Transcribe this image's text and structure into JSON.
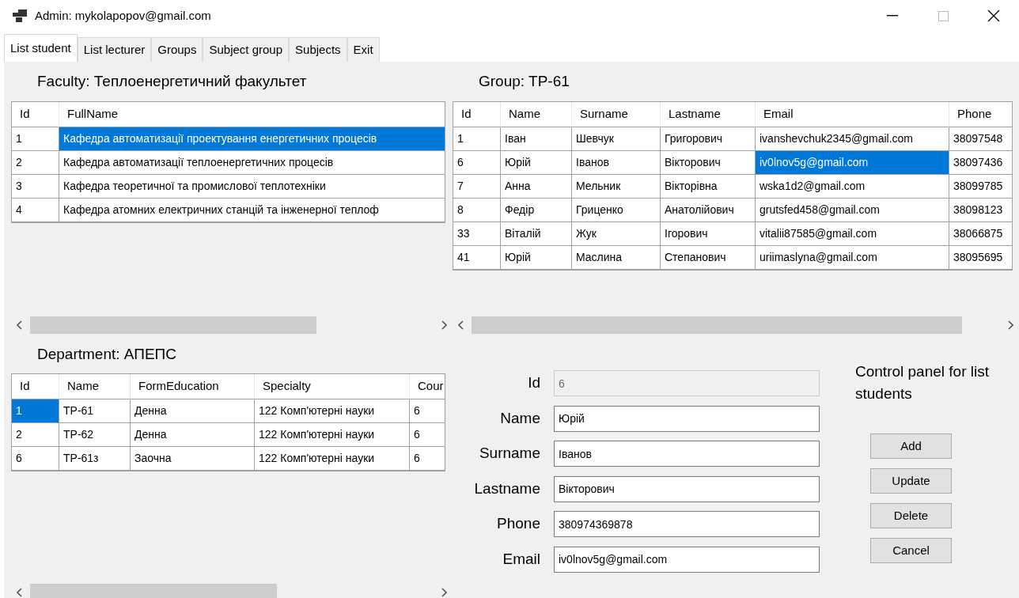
{
  "window": {
    "title": "Admin: mykolapopov@gmail.com"
  },
  "tabs": [
    {
      "label": "List student",
      "selected": true
    },
    {
      "label": "List lecturer",
      "selected": false
    },
    {
      "label": "Groups",
      "selected": false
    },
    {
      "label": "Subject group",
      "selected": false
    },
    {
      "label": "Subjects",
      "selected": false
    },
    {
      "label": "Exit",
      "selected": false
    }
  ],
  "faculty": {
    "heading": "Faculty: Теплоенергетичний факультет",
    "columns": [
      "Id",
      "FullName"
    ],
    "rows": [
      [
        {
          "text": "1",
          "selected": false
        },
        {
          "text": "Кафедра автоматизації проектування енергетичних процесів",
          "selected": true
        }
      ],
      [
        {
          "text": "2",
          "selected": false
        },
        {
          "text": "Кафедра автоматизації теплоенергетичних процесів",
          "selected": false
        }
      ],
      [
        {
          "text": "3",
          "selected": false
        },
        {
          "text": "Кафедра теоретичної та промислової теплотехніки",
          "selected": false
        }
      ],
      [
        {
          "text": "4",
          "selected": false
        },
        {
          "text": "Кафедра атомних електричних станцій та інженерної теплоф",
          "selected": false
        }
      ]
    ]
  },
  "group": {
    "heading": "Group: TP-61",
    "columns": [
      "Id",
      "Name",
      "Surname",
      "Lastname",
      "Email",
      "Phone"
    ],
    "rows": [
      [
        {
          "text": "1",
          "selected": false
        },
        {
          "text": "Іван",
          "selected": false
        },
        {
          "text": "Шевчук",
          "selected": false
        },
        {
          "text": "Григорович",
          "selected": false
        },
        {
          "text": "ivanshevchuk2345@gmail.com",
          "selected": false
        },
        {
          "text": "38097548",
          "selected": false
        }
      ],
      [
        {
          "text": "6",
          "selected": false
        },
        {
          "text": "Юрій",
          "selected": false
        },
        {
          "text": "Іванов",
          "selected": false
        },
        {
          "text": "Вікторович",
          "selected": false
        },
        {
          "text": "iv0lnov5g@gmail.com",
          "selected": true
        },
        {
          "text": "38097436",
          "selected": false
        }
      ],
      [
        {
          "text": "7",
          "selected": false
        },
        {
          "text": "Анна",
          "selected": false
        },
        {
          "text": "Мельник",
          "selected": false
        },
        {
          "text": "Вікторівна",
          "selected": false
        },
        {
          "text": "wska1d2@gmail.com",
          "selected": false
        },
        {
          "text": "38099785",
          "selected": false
        }
      ],
      [
        {
          "text": "8",
          "selected": false
        },
        {
          "text": "Федір",
          "selected": false
        },
        {
          "text": "Гриценко",
          "selected": false
        },
        {
          "text": "Анатолійович",
          "selected": false
        },
        {
          "text": "grutsfed458@gmail.com",
          "selected": false
        },
        {
          "text": "38098123",
          "selected": false
        }
      ],
      [
        {
          "text": "33",
          "selected": false
        },
        {
          "text": "Віталій",
          "selected": false
        },
        {
          "text": "Жук",
          "selected": false
        },
        {
          "text": "Ігорович",
          "selected": false
        },
        {
          "text": "vitalii87585@gmail.com",
          "selected": false
        },
        {
          "text": "38066875",
          "selected": false
        }
      ],
      [
        {
          "text": "41",
          "selected": false
        },
        {
          "text": "Юрій",
          "selected": false
        },
        {
          "text": "Маслина",
          "selected": false
        },
        {
          "text": "Степанович",
          "selected": false
        },
        {
          "text": "uriimaslyna@gmail.com",
          "selected": false
        },
        {
          "text": "38095695",
          "selected": false
        }
      ]
    ]
  },
  "department": {
    "heading": "Department: АПЕПС",
    "columns": [
      "Id",
      "Name",
      "FormEducation",
      "Specialty",
      "Cour"
    ],
    "rows": [
      [
        {
          "text": "1",
          "selected": true
        },
        {
          "text": "TP-61",
          "selected": false
        },
        {
          "text": "Денна",
          "selected": false
        },
        {
          "text": "122 Комп'ютерні науки",
          "selected": false
        },
        {
          "text": "6",
          "selected": false
        }
      ],
      [
        {
          "text": "2",
          "selected": false
        },
        {
          "text": "TP-62",
          "selected": false
        },
        {
          "text": "Денна",
          "selected": false
        },
        {
          "text": "122 Комп'ютерні науки",
          "selected": false
        },
        {
          "text": "6",
          "selected": false
        }
      ],
      [
        {
          "text": "6",
          "selected": false
        },
        {
          "text": "TP-61з",
          "selected": false
        },
        {
          "text": "Заочна",
          "selected": false
        },
        {
          "text": "122 Комп'ютерні науки",
          "selected": false
        },
        {
          "text": "6",
          "selected": false
        }
      ]
    ]
  },
  "form": {
    "fields": [
      {
        "label": "Id",
        "value": "6",
        "disabled": true
      },
      {
        "label": "Name",
        "value": "Юрій",
        "disabled": false
      },
      {
        "label": "Surname",
        "value": "Іванов",
        "disabled": false
      },
      {
        "label": "Lastname",
        "value": "Вікторович",
        "disabled": false
      },
      {
        "label": "Phone",
        "value": "380974369878",
        "disabled": false
      },
      {
        "label": "Email",
        "value": "iv0lnov5g@gmail.com",
        "disabled": false
      }
    ]
  },
  "control_panel": {
    "title": "Control panel for list students",
    "buttons": [
      "Add",
      "Update",
      "Delete",
      "Cancel"
    ]
  }
}
